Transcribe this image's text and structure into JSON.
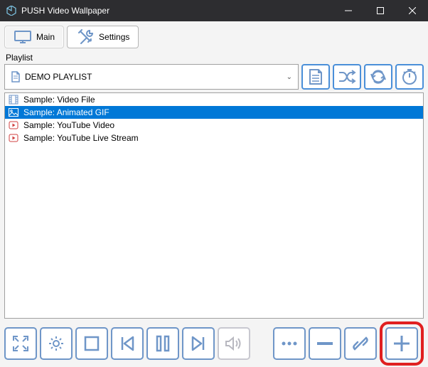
{
  "window": {
    "title": "PUSH Video Wallpaper"
  },
  "tabs": {
    "main": "Main",
    "settings": "Settings"
  },
  "playlist": {
    "label": "Playlist",
    "selected": "DEMO PLAYLIST",
    "items": [
      {
        "label": "Sample: Video File",
        "type": "video"
      },
      {
        "label": "Sample: Animated GIF",
        "type": "image",
        "selected": true
      },
      {
        "label": "Sample: YouTube Video",
        "type": "youtube"
      },
      {
        "label": "Sample: YouTube Live Stream",
        "type": "youtube"
      }
    ]
  },
  "colors": {
    "accent": "#6f96c8",
    "selection": "#0078d7",
    "highlight": "#e02020"
  }
}
